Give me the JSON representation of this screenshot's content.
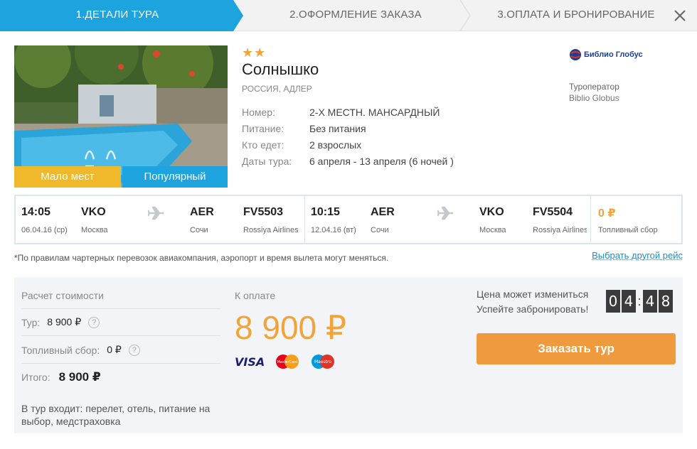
{
  "steps": [
    {
      "label": "1.Детали тура",
      "active": true
    },
    {
      "label": "2.Оформление заказа",
      "active": false
    },
    {
      "label": "3.Оплата и бронирование",
      "active": false
    }
  ],
  "colors": {
    "accent": "#1da3dd",
    "orange": "#f09a3e",
    "star": "#f0a43a",
    "badge_few": "#f0b92c"
  },
  "hotel": {
    "stars": "★★",
    "name": "Солнышко",
    "location": "РОССИЯ, АДЛЕР",
    "badges": {
      "few_places": "Мало мест",
      "popular": "Популярный"
    },
    "details": [
      {
        "label": "Номер:",
        "value": "2-Х МЕСТН. МАНСАРДНЫЙ"
      },
      {
        "label": "Питание:",
        "value": "Без питания"
      },
      {
        "label": "Кто едет:",
        "value": "2 взрослых"
      },
      {
        "label": "Даты тура:",
        "value": "6 апреля - 13 апреля (6 ночей )"
      }
    ]
  },
  "operator": {
    "logo_text": "Библио Глобус",
    "label": "Туроператор",
    "name": "Biblio Globus"
  },
  "flights": {
    "outbound": {
      "dep_time": "14:05",
      "dep_date": "06.04.16 (ср)",
      "from_code": "VKO",
      "from_city": "Москва",
      "to_code": "AER",
      "to_city": "Сочи",
      "flight_no": "FV5503",
      "airline": "Rossiya Airlines"
    },
    "return": {
      "dep_time": "10:15",
      "dep_date": "12.04.16 (вт)",
      "from_code": "AER",
      "from_city": "Сочи",
      "to_code": "VKO",
      "to_city": "Москва",
      "flight_no": "FV5504",
      "airline": "Rossiya Airlines"
    },
    "fuel": {
      "price": "0 ₽",
      "label": "Топливный сбор"
    }
  },
  "note": "*По правилам чартерных перевозок авиакомпания, аэропорт и время вылета могут меняться.",
  "other_flight_link": "Выбрать другой рейс",
  "calc": {
    "title": "Расчет стоимости",
    "tour_label": "Тур:",
    "tour_value": "8 900 ₽",
    "fuel_label": "Топливный сбор:",
    "fuel_value": "0 ₽",
    "total_label": "Итого:",
    "total_value": "8 900 ₽",
    "includes": "В тур входит: перелет, отель, питание на выбор, медстраховка"
  },
  "payment": {
    "label": "К оплате",
    "amount": "8 900 ₽",
    "cards": [
      "VISA",
      "MasterCard",
      "Maestro"
    ]
  },
  "timer": {
    "warn_line1": "Цена может измениться",
    "warn_line2": "Успейте забронировать!",
    "digits": [
      "0",
      "4",
      "4",
      "8"
    ]
  },
  "order_button": "Заказать тур"
}
